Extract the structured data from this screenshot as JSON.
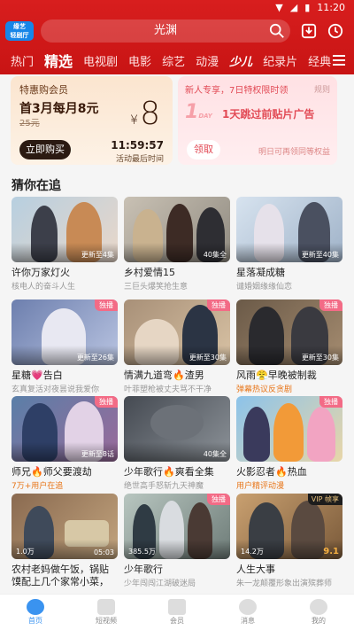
{
  "status": {
    "time": "11:20"
  },
  "header": {
    "logo_text": [
      "缘艺",
      "轻剧厅"
    ],
    "search_placeholder": "光渊",
    "tabs": [
      "热门",
      "精选",
      "电视剧",
      "电影",
      "综艺",
      "动漫",
      "少儿",
      "纪录片",
      "经典"
    ],
    "active_tab": "精选"
  },
  "promo_left": {
    "title": "特惠购会员",
    "price": "首3月每月8元",
    "original": "25元",
    "big_price": "8",
    "currency": "¥",
    "button": "立即购买",
    "countdown": "11:59:57",
    "countdown_label": "活动最后时间"
  },
  "promo_right": {
    "head": "新人专享，7日特权限时领",
    "rule": "规则",
    "day_big": "1",
    "day_small": "DAY",
    "text": "1天跳过前贴片广告",
    "button": "领取",
    "note": "明日可再领同等权益"
  },
  "section_title": "猜你在追",
  "cards": [
    {
      "title": "许你万家灯火",
      "sub": "核电人的奋斗人生",
      "badge": "更新至4集",
      "tag": "",
      "sub_hot": false
    },
    {
      "title": "乡村爱情15",
      "sub": "三巨头爆笑抢生意",
      "badge": "40集全",
      "tag": "",
      "sub_hot": false
    },
    {
      "title": "星落凝成糖",
      "sub": "谴婚姻缘缘仙恋",
      "badge": "更新至40集",
      "tag": "",
      "sub_hot": false
    },
    {
      "title": "星糖💗告白",
      "sub": "玄真复活对夜昙说我爱你",
      "badge": "更新至26集",
      "tag": "独播",
      "sub_hot": false
    },
    {
      "title": "情满九道弯🔥渣男",
      "sub": "叶菲塑枪被丈夫骂不干净",
      "badge": "更新至30集",
      "tag": "独播",
      "sub_hot": false
    },
    {
      "title": "风雨😤早晚被制裁",
      "sub": "弹幕热议反贪剧",
      "badge": "更新至30集",
      "tag": "独播",
      "sub_hot": true
    },
    {
      "title": "师兄🔥师父要渡劫",
      "sub": "7万+用户在追",
      "badge": "更新至8话",
      "tag": "独播",
      "sub_hot": true
    },
    {
      "title": "少年歌行🔥爽看全集",
      "sub": "绝世高手怒斩九天神魔",
      "badge": "40集全",
      "tag": "",
      "sub_hot": false
    },
    {
      "title": "火影忍者🔥热血",
      "sub": "用户精评动漫",
      "badge": "",
      "tag": "独播",
      "sub_hot": true
    },
    {
      "title": "农村老妈做午饭，锅贴馍配上几个家常小菜，简...",
      "sub": "",
      "badge": "05:03",
      "plays": "1.0万",
      "tag": "",
      "sub_hot": false
    },
    {
      "title": "少年歌行",
      "sub": "少年闯闯江湖破迷局",
      "badge": "",
      "plays": "385.5万",
      "tag": "独播",
      "sub_hot": false
    },
    {
      "title": "人生大事",
      "sub": "朱一龙颠覆形象出演殡葬师",
      "badge": "9.1",
      "plays": "14.2万",
      "tag": "VIP 帧享",
      "sub_hot": false
    }
  ],
  "bottom_nav": [
    "首页",
    "短视频",
    "会员",
    "消息",
    "我的"
  ],
  "colors": {
    "brand_red": "#d81e1e",
    "active_blue": "#3a93f0",
    "tag_pink": "#f36b86"
  }
}
